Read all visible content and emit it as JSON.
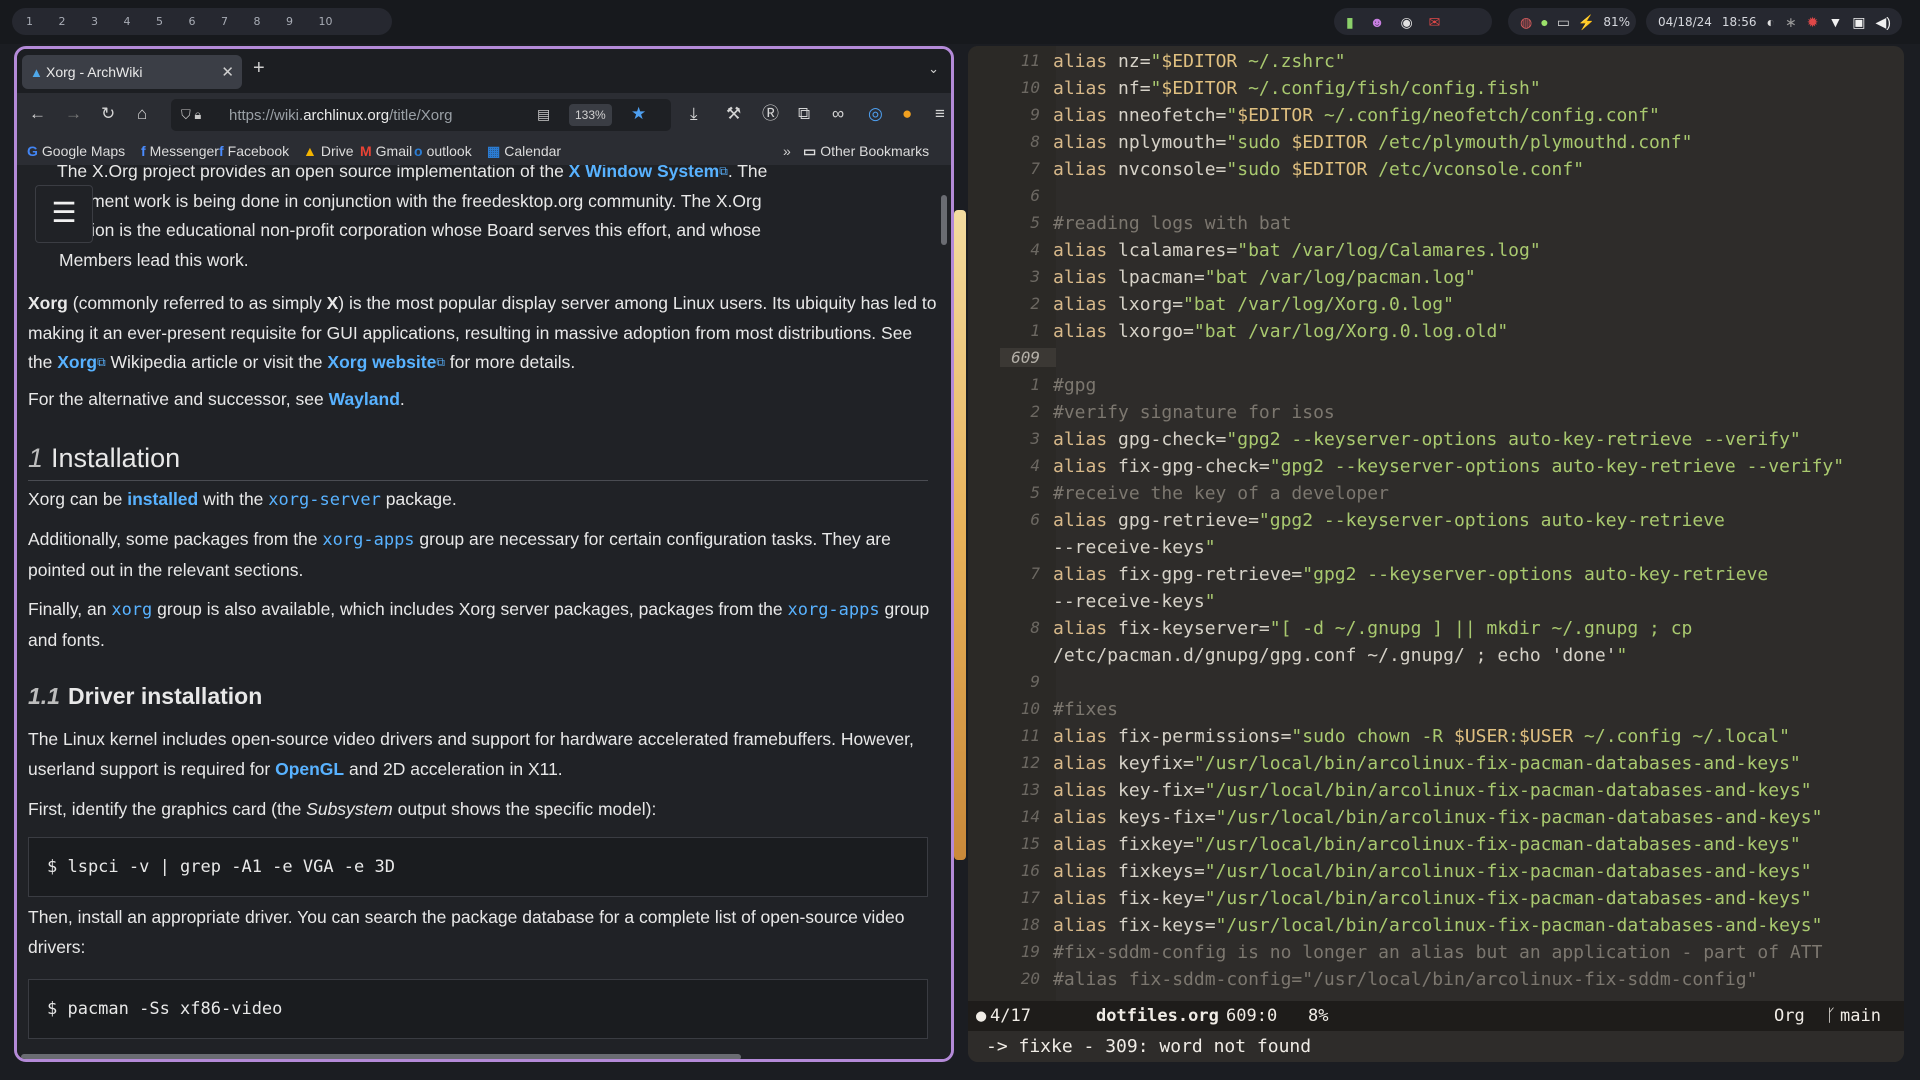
{
  "topbar": {
    "workspaces": [
      "1",
      "2",
      "3",
      "4",
      "5",
      "6",
      "7",
      "8",
      "9",
      "10"
    ],
    "battery": "81%",
    "date": "04/18/24",
    "time": "18:56"
  },
  "browser": {
    "tab_title": "Xorg - ArchWiki",
    "new_tab": "+",
    "url_prefix": "https://wiki.",
    "url_domain": "archlinux.org",
    "url_path": "/title/Xorg",
    "zoom": "133%",
    "bookmarks": [
      "Google Maps",
      "Messenger",
      "Facebook",
      "Drive",
      "Gmail",
      "outlook",
      "Calendar"
    ],
    "other_bookmarks": "Other Bookmarks"
  },
  "article": {
    "p1a": "The X.Org project provides an open source implementation of the ",
    "p1_link": "X Window System",
    "p1b": ". The",
    "p1_line2": "elopment work is being done in conjunction with the freedesktop.org community. The X.Org",
    "p1_line3": "ndation is the educational non-profit corporation whose Board serves this effort, and whose",
    "p1_line4": "Members lead this work.",
    "p2_bold": "Xorg",
    "p2a": " (commonly referred to as simply ",
    "p2_x": "X",
    "p2b": ") is the most popular display server among Linux users. Its ubiquity has led to making it an ever-present requisite for GUI applications, resulting in massive adoption from most distributions. See the ",
    "p2_link1": "Xorg",
    "p2c": " Wikipedia article or visit the ",
    "p2_link2": "Xorg website",
    "p2d": " for more details.",
    "p3a": "For the alternative and successor, see ",
    "p3_link": "Wayland",
    "p3b": ".",
    "h_install_num": "1",
    "h_install": "Installation",
    "p4a": "Xorg can be ",
    "p4_link": "installed",
    "p4b": " with the ",
    "p4_code": "xorg-server",
    "p4c": " package.",
    "p5a": "Additionally, some packages from the ",
    "p5_code": "xorg-apps",
    "p5b": " group are necessary for certain configuration tasks. They are pointed out in the relevant sections.",
    "p6a": "Finally, an ",
    "p6_code1": "xorg",
    "p6b": " group is also available, which includes Xorg server packages, packages from the ",
    "p6_code2": "xorg-apps",
    "p6c": " group and fonts.",
    "h_driver_num": "1.1",
    "h_driver": "Driver installation",
    "p7a": "The Linux kernel includes open-source video drivers and support for hardware accelerated framebuffers. However, userland support is required for ",
    "p7_link": "OpenGL",
    "p7b": " and 2D acceleration in X11.",
    "p8a": "First, identify the graphics card (the ",
    "p8_em": "Subsystem",
    "p8b": " output shows the specific model):",
    "cmd1": "$ lspci -v | grep -A1 -e VGA -e 3D",
    "p9": "Then, install an appropriate driver. You can search the package database for a complete list of open-source video drivers:",
    "cmd2": "$ pacman -Ss xf86-video"
  },
  "editor": {
    "line_numbers": [
      "11",
      "10",
      "9",
      "8",
      "7",
      "6",
      "5",
      "4",
      "3",
      "2",
      "1",
      "609",
      "1",
      "2",
      "3",
      "4",
      "5",
      "6",
      "",
      "7",
      "",
      "8",
      "",
      "9",
      "10",
      "11",
      "12",
      "13",
      "14",
      "15",
      "16",
      "17",
      "18",
      "19",
      "20"
    ],
    "lines": [
      "alias nz=\"$EDITOR ~/.zshrc\"",
      "alias nf=\"$EDITOR ~/.config/fish/config.fish\"",
      "alias nneofetch=\"$EDITOR ~/.config/neofetch/config.conf\"",
      "alias nplymouth=\"sudo $EDITOR /etc/plymouth/plymouthd.conf\"",
      "alias nvconsole=\"sudo $EDITOR /etc/vconsole.conf\"",
      "",
      "#reading logs with bat",
      "alias lcalamares=\"bat /var/log/Calamares.log\"",
      "alias lpacman=\"bat /var/log/pacman.log\"",
      "alias lxorg=\"bat /var/log/Xorg.0.log\"",
      "alias lxorgo=\"bat /var/log/Xorg.0.log.old\"",
      "",
      "#gpg",
      "#verify signature for isos",
      "alias gpg-check=\"gpg2 --keyserver-options auto-key-retrieve --verify\"",
      "alias fix-gpg-check=\"gpg2 --keyserver-options auto-key-retrieve --verify\"",
      "#receive the key of a developer",
      "alias gpg-retrieve=\"gpg2 --keyserver-options auto-key-retrieve",
      "--receive-keys\"",
      "alias fix-gpg-retrieve=\"gpg2 --keyserver-options auto-key-retrieve",
      "--receive-keys\"",
      "alias fix-keyserver=\"[ -d ~/.gnupg ] || mkdir ~/.gnupg ; cp",
      "/etc/pacman.d/gnupg/gpg.conf ~/.gnupg/ ; echo 'done'\"",
      "",
      "#fixes",
      "alias fix-permissions=\"sudo chown -R $USER:$USER ~/.config ~/.local\"",
      "alias keyfix=\"/usr/local/bin/arcolinux-fix-pacman-databases-and-keys\"",
      "alias key-fix=\"/usr/local/bin/arcolinux-fix-pacman-databases-and-keys\"",
      "alias keys-fix=\"/usr/local/bin/arcolinux-fix-pacman-databases-and-keys\"",
      "alias fixkey=\"/usr/local/bin/arcolinux-fix-pacman-databases-and-keys\"",
      "alias fixkeys=\"/usr/local/bin/arcolinux-fix-pacman-databases-and-keys\"",
      "alias fix-key=\"/usr/local/bin/arcolinux-fix-pacman-databases-and-keys\"",
      "alias fix-keys=\"/usr/local/bin/arcolinux-fix-pacman-databases-and-keys\"",
      "#fix-sddm-config is no longer an alias but an application - part of ATT",
      "#alias fix-sddm-config=\"/usr/local/bin/arcolinux-fix-sddm-config\""
    ],
    "modeline": {
      "position": "4/17",
      "buffer": "dotfiles.org",
      "cursor": "609:0",
      "percent": "8%",
      "mode": "Org",
      "branch": "main"
    },
    "minibuffer": "-> fixke - 309: word not found"
  }
}
